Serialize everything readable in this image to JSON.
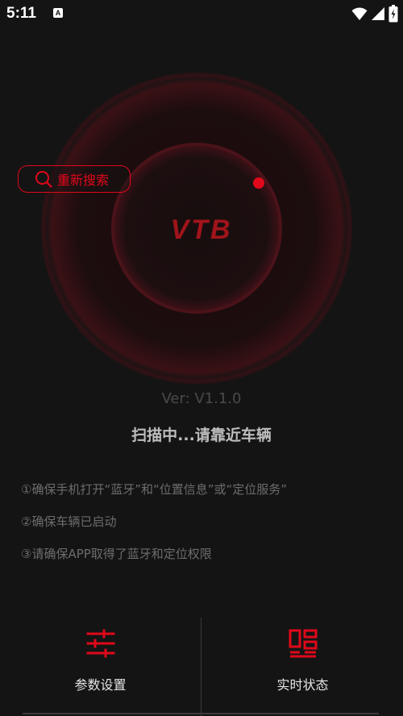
{
  "status_bar": {
    "time": "5:11",
    "notification_icon": "a-icon",
    "icons": [
      "wifi-icon",
      "signal-icon",
      "battery-icon"
    ]
  },
  "radar": {
    "logo_text": "VTB",
    "accent_color": "#e0081a"
  },
  "research_button": {
    "label": "重新搜索",
    "icon": "search-icon"
  },
  "version": "Ver: V1.1.0",
  "scan_status": "扫描中...请靠近车辆",
  "tips": [
    "①确保手机打开“蓝牙”和“位置信息”或“定位服务”",
    "②确保车辆已启动",
    "③请确保APP取得了蓝牙和定位权限"
  ],
  "bottom_nav": [
    {
      "label": "参数设置",
      "icon": "sliders-icon"
    },
    {
      "label": "实时状态",
      "icon": "dashboard-icon"
    }
  ]
}
